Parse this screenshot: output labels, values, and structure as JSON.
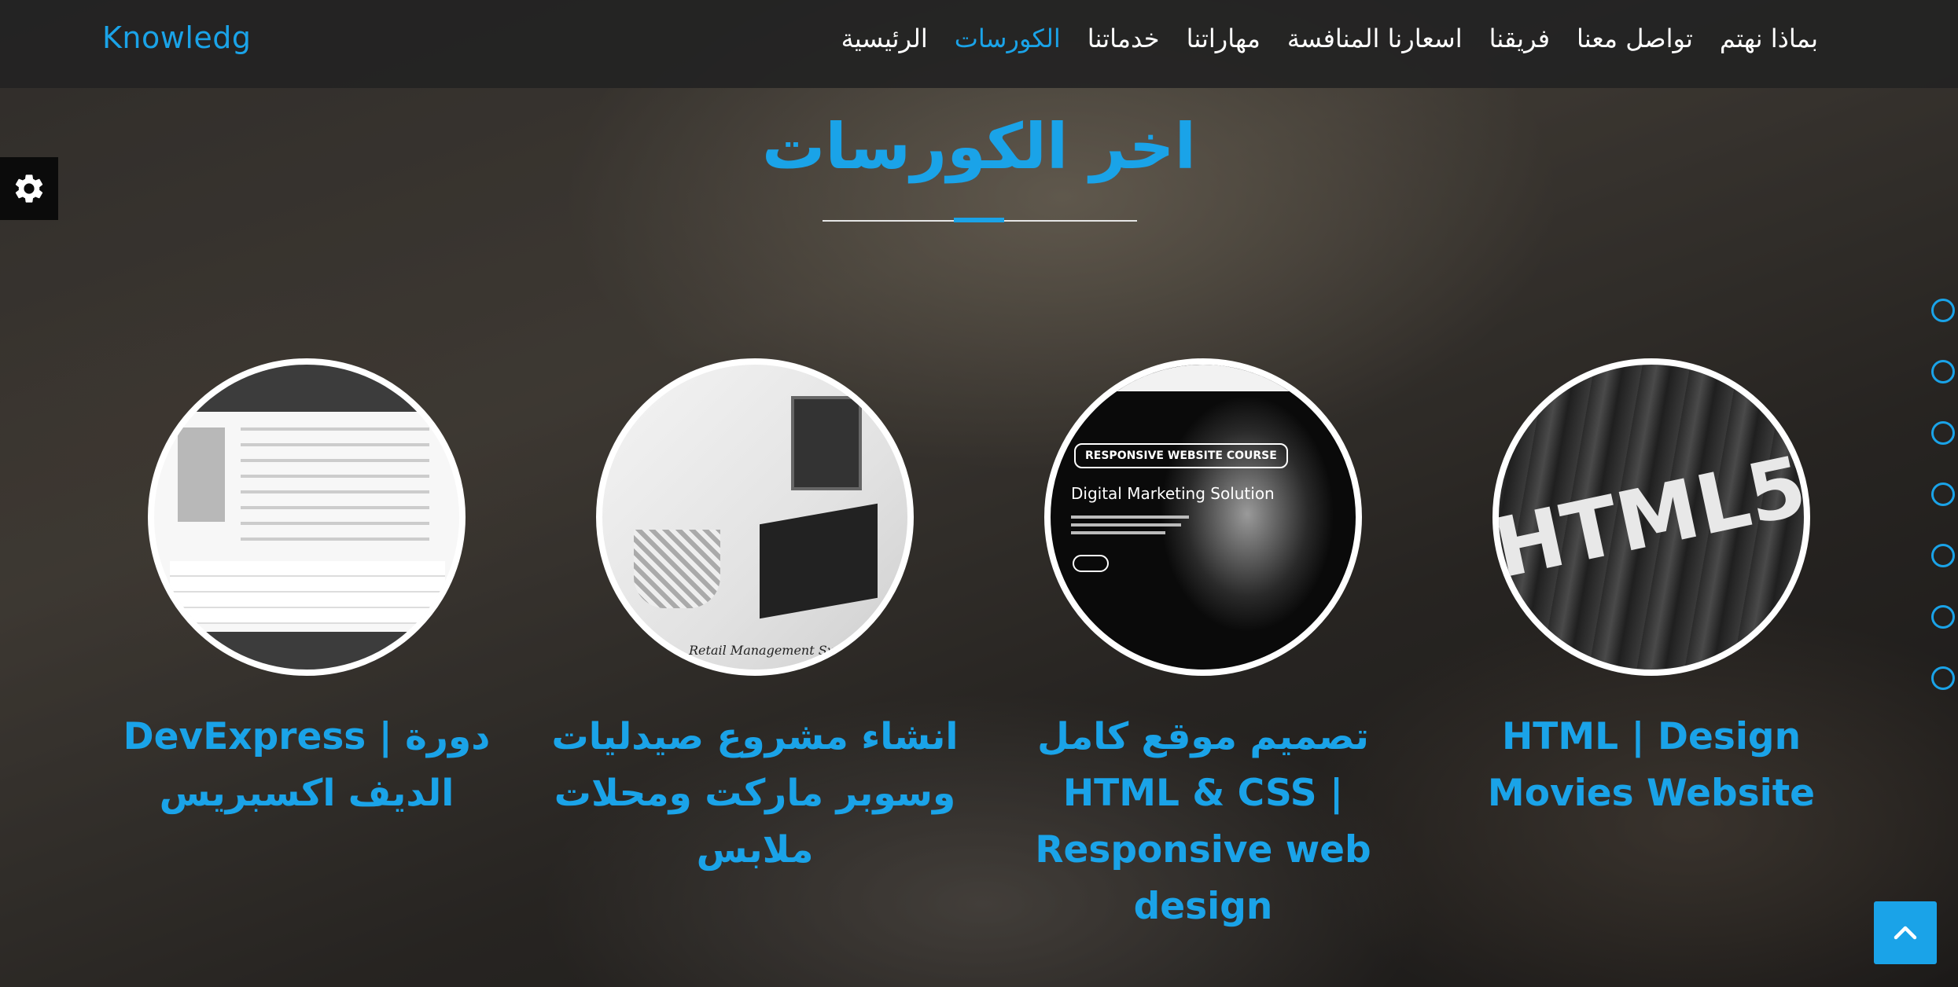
{
  "brand": "Knowledg",
  "nav": {
    "items": [
      {
        "label": "الرئيسية",
        "active": false
      },
      {
        "label": "الكورسات",
        "active": true
      },
      {
        "label": "خدماتنا",
        "active": false
      },
      {
        "label": "مهاراتنا",
        "active": false
      },
      {
        "label": "اسعارنا المنافسة",
        "active": false
      },
      {
        "label": "فريقنا",
        "active": false
      },
      {
        "label": "تواصل معنا",
        "active": false
      },
      {
        "label": "بماذا نهتم",
        "active": false
      }
    ]
  },
  "section": {
    "title": "اخر الكورسات"
  },
  "courses": [
    {
      "title": "HTML | Design Movies Website",
      "image_text": "HTML5"
    },
    {
      "title": "تصميم موقع كامل HTML & CSS | Responsive web design",
      "image_badge": "RESPONSIVE WEBSITE COURSE",
      "image_heading": "Digital Marketing Solution"
    },
    {
      "title": "انشاء مشروع صيدليات وسوبر ماركت ومحلات ملابس",
      "image_caption": "Retail Management System"
    },
    {
      "title": "DevExpress | دورة الديف اكسبريس"
    }
  ],
  "colors": {
    "accent": "#1aa3e8",
    "navbar": "#232323",
    "white": "#ffffff"
  },
  "dot_nav_count": 7
}
